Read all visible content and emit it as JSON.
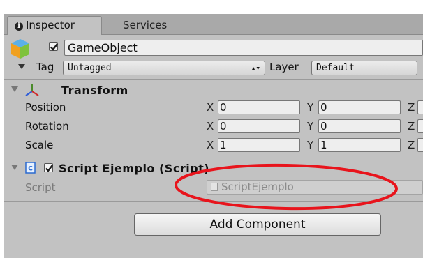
{
  "tabs": [
    {
      "label": "Inspector",
      "icon": "info-icon",
      "active": true
    },
    {
      "label": "Services",
      "active": false
    }
  ],
  "gameobject": {
    "active": true,
    "name": "GameObject",
    "tag_label": "Tag",
    "tag_value": "Untagged",
    "layer_label": "Layer",
    "layer_value": "Default"
  },
  "transform": {
    "title": "Transform",
    "rows": [
      {
        "label": "Position",
        "x": "0",
        "y": "0"
      },
      {
        "label": "Rotation",
        "x": "0",
        "y": "0"
      },
      {
        "label": "Scale",
        "x": "1",
        "y": "1"
      }
    ],
    "axis_labels": {
      "x": "X",
      "y": "Y",
      "z": "Z"
    }
  },
  "script_component": {
    "enabled": true,
    "title": "Script Ejemplo (Script)",
    "field_label": "Script",
    "field_value": "ScriptEjemplo"
  },
  "add_component_label": "Add Component",
  "colors": {
    "annotation": "#e8141c",
    "panel_bg": "#c2c2c2",
    "tab_bar": "#a9a9a9"
  }
}
